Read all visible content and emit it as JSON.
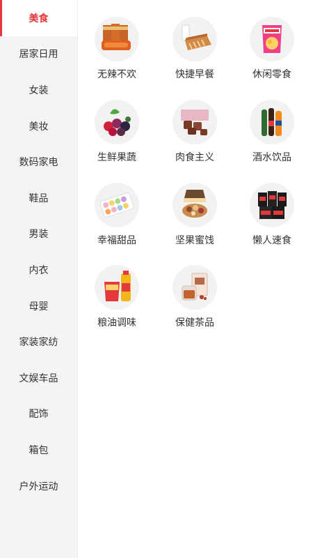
{
  "sidebar": {
    "items": [
      {
        "label": "美食",
        "active": true
      },
      {
        "label": "居家日用"
      },
      {
        "label": "女装"
      },
      {
        "label": "美妆"
      },
      {
        "label": "数码家电"
      },
      {
        "label": "鞋品"
      },
      {
        "label": "男装"
      },
      {
        "label": "内衣"
      },
      {
        "label": "母婴"
      },
      {
        "label": "家装家纺"
      },
      {
        "label": "文娱车品"
      },
      {
        "label": "配饰"
      },
      {
        "label": "箱包"
      },
      {
        "label": "户外运动"
      }
    ]
  },
  "categories": [
    {
      "label": "无辣不欢",
      "icon": "spicy-snack-icon"
    },
    {
      "label": "快捷早餐",
      "icon": "bread-milk-icon"
    },
    {
      "label": "休闲零食",
      "icon": "chips-bag-icon"
    },
    {
      "label": "生鲜果蔬",
      "icon": "berries-icon"
    },
    {
      "label": "肉食主义",
      "icon": "meat-icon"
    },
    {
      "label": "酒水饮品",
      "icon": "bottles-icon"
    },
    {
      "label": "幸福甜品",
      "icon": "macaron-box-icon"
    },
    {
      "label": "坚果蜜饯",
      "icon": "nuts-box-icon"
    },
    {
      "label": "懒人速食",
      "icon": "instant-noodles-icon"
    },
    {
      "label": "粮油调味",
      "icon": "rice-oil-icon"
    },
    {
      "label": "保健茶品",
      "icon": "tea-icon"
    }
  ],
  "colors": {
    "accent": "#e4393c",
    "sidebar_bg": "#f4f4f4",
    "text": "#333333"
  }
}
